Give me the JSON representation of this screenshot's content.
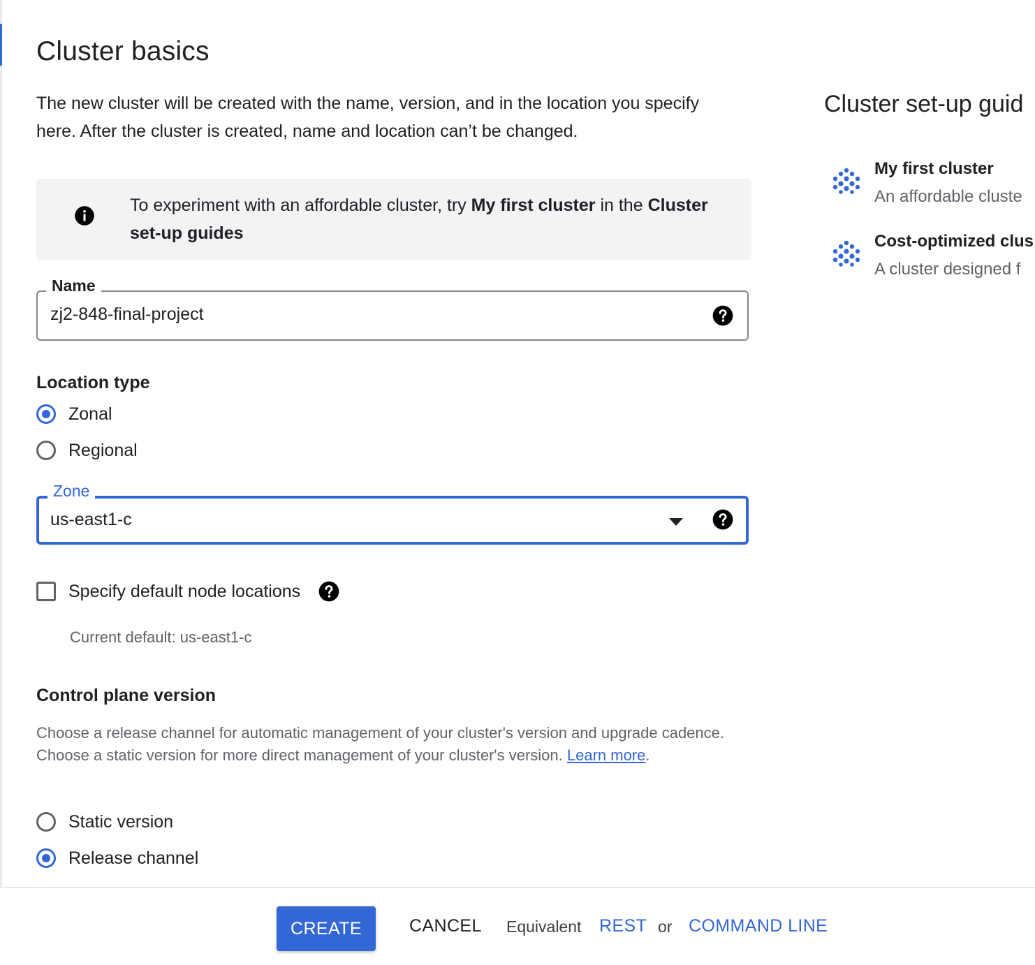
{
  "page": {
    "title": "Cluster basics",
    "intro": "The new cluster will be created with the name, version, and in the location you specify here. After the cluster is created, name and location can’t be changed."
  },
  "banner": {
    "icon": "info-icon",
    "text_before": "To experiment with an affordable cluster, try ",
    "bold_1": "My first cluster",
    "text_middle": " in the ",
    "bold_2": "Cluster set-up guides"
  },
  "name_field": {
    "label": "Name",
    "value": "zj2-848-final-project",
    "icon": "help-icon"
  },
  "location_type": {
    "heading": "Location type",
    "options": [
      {
        "label": "Zonal",
        "checked": true
      },
      {
        "label": "Regional",
        "checked": false
      }
    ]
  },
  "zone_field": {
    "label": "Zone",
    "value": "us-east1-c",
    "icon": "help-icon"
  },
  "node_locations": {
    "label": "Specify default node locations",
    "checked": false,
    "hint": "Current default: us-east1-c"
  },
  "control_plane": {
    "heading": "Control plane version",
    "description": "Choose a release channel for automatic management of your cluster's version and upgrade cadence. Choose a static version for more direct management of your cluster's version. ",
    "learn_more": "Learn more",
    "period": ".",
    "options": [
      {
        "label": "Static version",
        "checked": false
      },
      {
        "label": "Release channel",
        "checked": true
      }
    ]
  },
  "side_panel": {
    "title": "Cluster set-up guid",
    "guides": [
      {
        "title": "My first cluster",
        "description": "An affordable cluste",
        "icon": "cluster-dots-icon"
      },
      {
        "title": "Cost-optimized clus",
        "description": "A cluster designed f",
        "icon": "cluster-dots-icon"
      }
    ]
  },
  "footer": {
    "create": "CREATE",
    "cancel": "CANCEL",
    "equivalent": "Equivalent",
    "rest": "REST",
    "or": "or",
    "command_line": "COMMAND LINE"
  },
  "colors": {
    "accent": "#3367d6",
    "text": "#202124",
    "secondary_text": "#5f6368",
    "banner_bg": "#f1f3f4"
  }
}
